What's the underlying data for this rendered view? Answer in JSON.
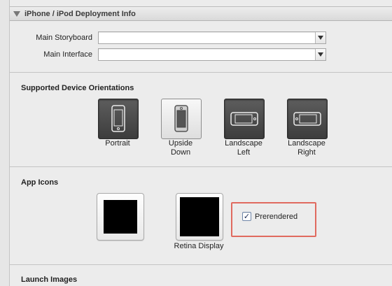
{
  "section": {
    "title": "iPhone / iPod Deployment Info"
  },
  "form": {
    "main_storyboard_label": "Main Storyboard",
    "main_storyboard_value": "",
    "main_interface_label": "Main Interface",
    "main_interface_value": ""
  },
  "orientations": {
    "title": "Supported Device Orientations",
    "items": [
      {
        "label": "Portrait",
        "selected": true
      },
      {
        "label": "Upside\nDown",
        "selected": false
      },
      {
        "label": "Landscape\nLeft",
        "selected": true
      },
      {
        "label": "Landscape\nRight",
        "selected": true
      }
    ]
  },
  "app_icons": {
    "title": "App Icons",
    "retina_label": "Retina Display",
    "prerendered_label": "Prerendered",
    "prerendered_checked": true
  },
  "launch_images": {
    "title": "Launch Images"
  },
  "colors": {
    "highlight": "#e06a5f",
    "selected_button": "#4a4a4a"
  }
}
